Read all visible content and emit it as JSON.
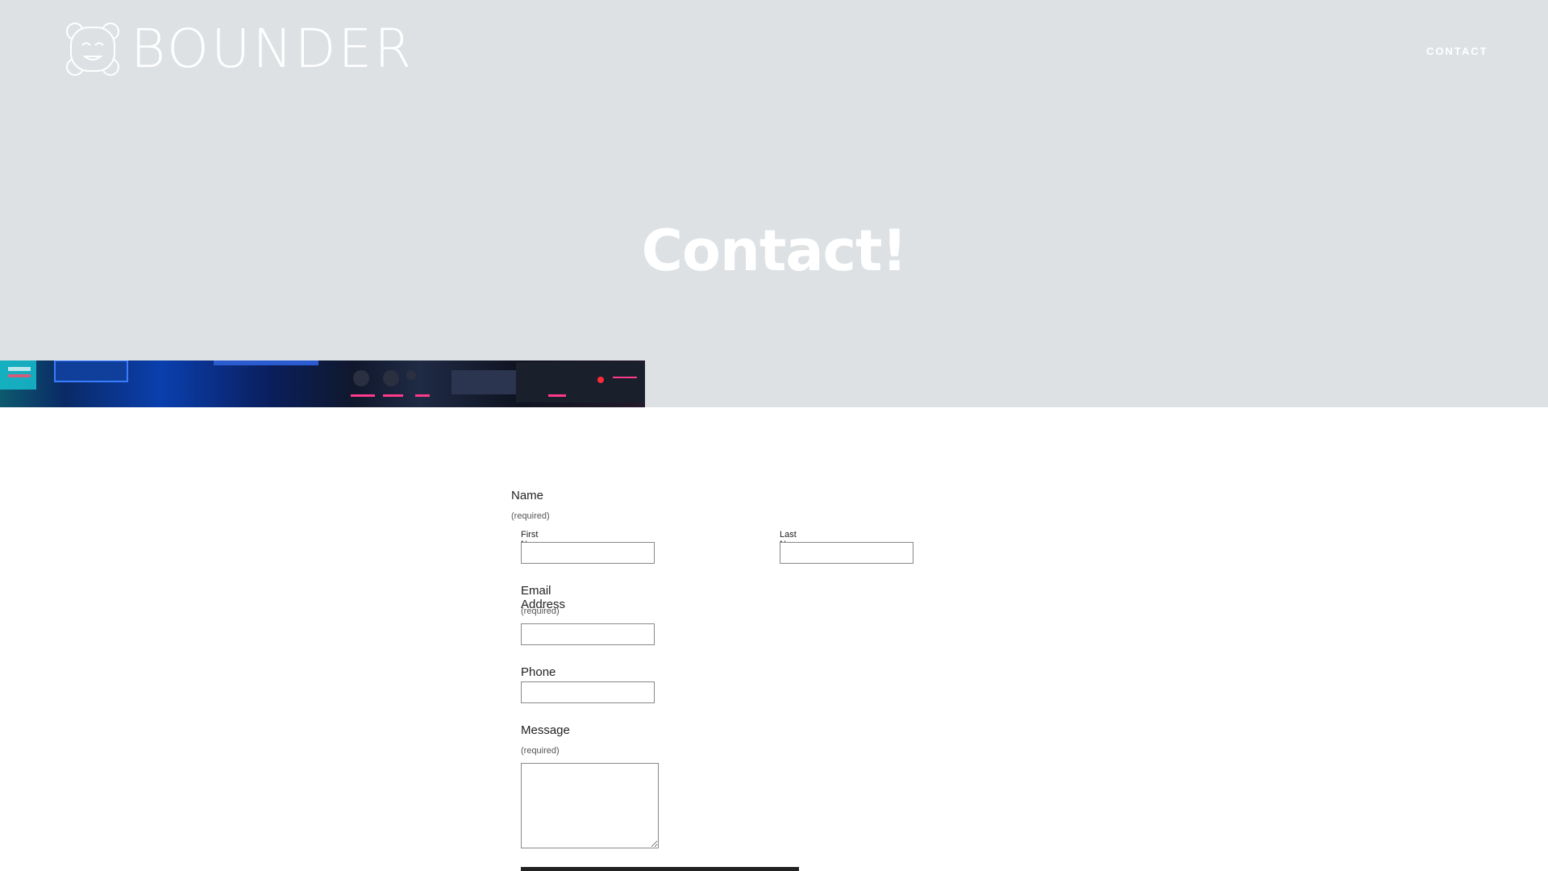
{
  "site": {
    "brand": "BOUNDER",
    "nav": {
      "contact": "CONTACT"
    }
  },
  "hero": {
    "title": "Contact!",
    "image": "control-panel-photo"
  },
  "form": {
    "name": {
      "label": "Name",
      "required": "(required)",
      "first_label": "First Name",
      "last_label": "Last Name",
      "first_value": "",
      "last_value": ""
    },
    "email": {
      "label": "Email Address",
      "required": "(required)",
      "value": ""
    },
    "phone": {
      "label": "Phone",
      "value": ""
    },
    "message": {
      "label": "Message",
      "required": "(required)",
      "value": ""
    }
  },
  "colors": {
    "hero_bg": "#dde1e4",
    "page_bg": "#ffffff",
    "text": "#222222"
  }
}
